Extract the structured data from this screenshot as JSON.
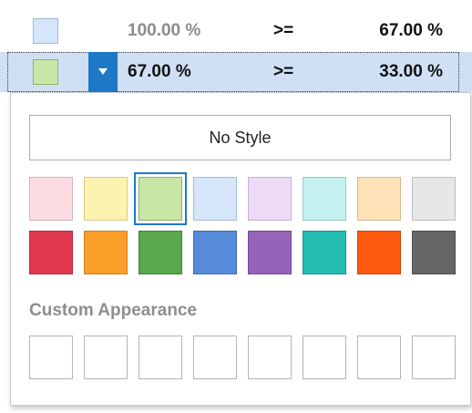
{
  "rows": [
    {
      "color": "#d5e6fb",
      "border": "#9eb8d8",
      "value_from": "100.00 %",
      "operator": ">=",
      "value_to": "67.00 %"
    },
    {
      "color": "#c8e7a6",
      "border": "#90b36e",
      "value_from": "67.00 %",
      "operator": ">=",
      "value_to": "33.00 %",
      "dropdown_icon": "triangle-down-icon"
    }
  ],
  "popup": {
    "no_style_label": "No Style",
    "selected": "light-green",
    "palette_light": [
      {
        "name": "light-red",
        "fill": "#fddde3",
        "border": "#d5b4ba"
      },
      {
        "name": "light-yellow",
        "fill": "#fdf2b0",
        "border": "#d8c889"
      },
      {
        "name": "light-green",
        "fill": "#c8e7a6",
        "border": "#8bb265"
      },
      {
        "name": "light-blue",
        "fill": "#d6e6fb",
        "border": "#a4bad8"
      },
      {
        "name": "light-purple",
        "fill": "#eddaf7",
        "border": "#c5b1d3"
      },
      {
        "name": "light-cyan",
        "fill": "#c4f1ef",
        "border": "#8fcdc9"
      },
      {
        "name": "light-orange",
        "fill": "#fde1b7",
        "border": "#d7b98c"
      },
      {
        "name": "light-gray",
        "fill": "#e7e7e7",
        "border": "#bdbdbd"
      }
    ],
    "palette_dark": [
      {
        "name": "red",
        "fill": "#e0384f",
        "border": "#b52a3c"
      },
      {
        "name": "orange",
        "fill": "#fb9e29",
        "border": "#cc7f1e"
      },
      {
        "name": "green",
        "fill": "#5aa94c",
        "border": "#427e38"
      },
      {
        "name": "blue",
        "fill": "#568bd9",
        "border": "#3e6bae"
      },
      {
        "name": "purple",
        "fill": "#9564b8",
        "border": "#744a91"
      },
      {
        "name": "teal",
        "fill": "#23bdb4",
        "border": "#18928b"
      },
      {
        "name": "dark-orange",
        "fill": "#fd590f",
        "border": "#cb4507"
      },
      {
        "name": "dark-gray",
        "fill": "#666666",
        "border": "#4a4a4a"
      }
    ],
    "custom_title": "Custom Appearance",
    "custom_slots": 8
  }
}
